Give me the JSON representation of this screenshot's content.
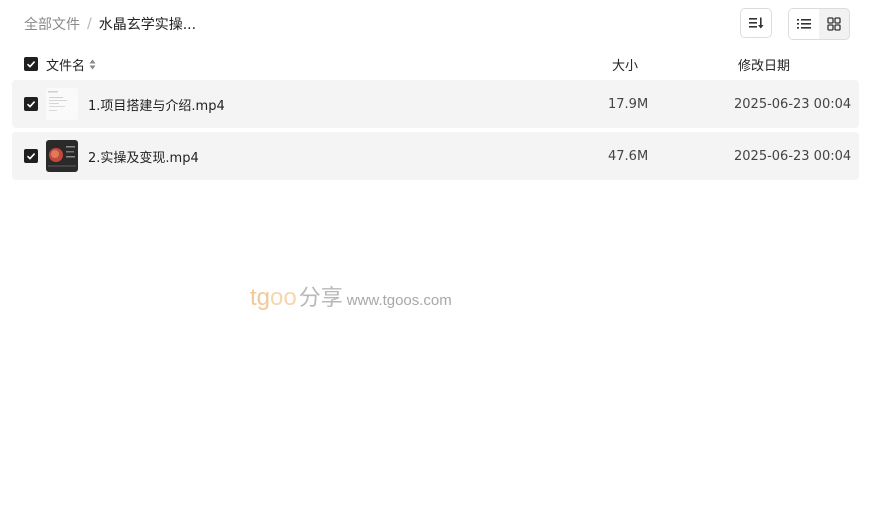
{
  "breadcrumb": {
    "root": "全部文件",
    "separator": "/",
    "current": "水晶玄学实操..."
  },
  "toolbar": {
    "sort_icon": "sort-icon",
    "list_view_icon": "list-view-icon",
    "grid_view_icon": "grid-view-icon",
    "active_view": "list"
  },
  "table": {
    "headers": {
      "name": "文件名",
      "size": "大小",
      "date": "修改日期"
    },
    "header_checked": true,
    "rows": [
      {
        "name": "1.项目搭建与介绍.mp4",
        "size": "17.9M",
        "date": "2025-06-23 00:04",
        "checked": true,
        "thumb": "light"
      },
      {
        "name": "2.实操及变现.mp4",
        "size": "47.6M",
        "date": "2025-06-23 00:04",
        "checked": true,
        "thumb": "dark"
      }
    ]
  },
  "watermark": {
    "brand_t": "tg",
    "brand_oo": "oo",
    "brand_cn": "分享",
    "url": "www.tgoos.com"
  },
  "colors": {
    "row_bg": "#f4f4f4",
    "checkbox": "#1f1f1f",
    "muted_text": "#8a8a8a"
  }
}
